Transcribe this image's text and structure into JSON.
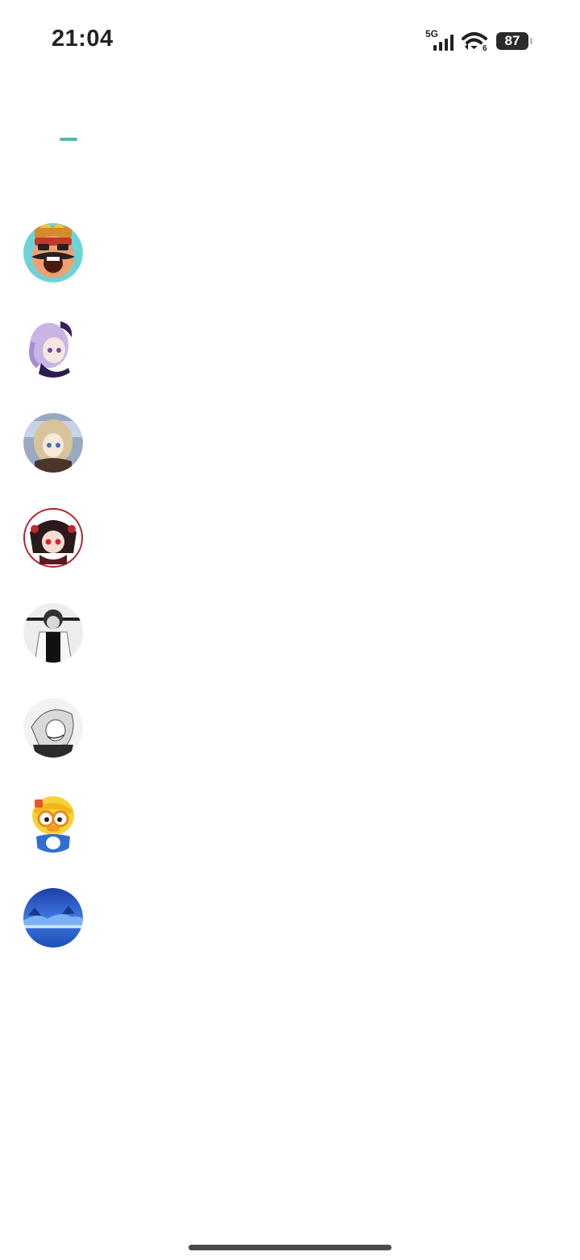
{
  "status_bar": {
    "time": "21:04",
    "network": "5G",
    "battery": "87",
    "wifi_badge": "6"
  },
  "list": {
    "items": [
      {
        "avatar": "king-mustache-avatar"
      },
      {
        "avatar": "purple-hair-anime-girl-avatar"
      },
      {
        "avatar": "blonde-anime-girl-avatar"
      },
      {
        "avatar": "red-eyed-anime-girl-avatar"
      },
      {
        "avatar": "monochrome-boy-avatar"
      },
      {
        "avatar": "sketch-anime-girl-avatar"
      },
      {
        "avatar": "penguin-mascot-avatar"
      },
      {
        "avatar": "blue-landscape-avatar"
      }
    ]
  },
  "colors": {
    "accent": "#5bb5a8",
    "text": "#222222",
    "background": "#ffffff"
  }
}
